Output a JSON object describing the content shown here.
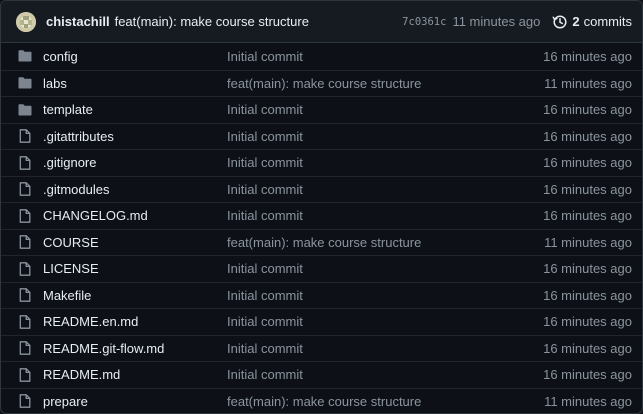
{
  "latest_commit": {
    "author": "chistachill",
    "message": "feat(main): make course structure",
    "sha": "7c0361c",
    "time": "11 minutes ago",
    "commits_count": "2",
    "commits_label": "commits",
    "history_icon": "history-icon"
  },
  "files": [
    {
      "type": "folder",
      "name": "config",
      "message": "Initial commit",
      "age": "16 minutes ago"
    },
    {
      "type": "folder",
      "name": "labs",
      "message": "feat(main): make course structure",
      "age": "11 minutes ago"
    },
    {
      "type": "folder",
      "name": "template",
      "message": "Initial commit",
      "age": "16 minutes ago"
    },
    {
      "type": "file",
      "name": ".gitattributes",
      "message": "Initial commit",
      "age": "16 minutes ago"
    },
    {
      "type": "file",
      "name": ".gitignore",
      "message": "Initial commit",
      "age": "16 minutes ago"
    },
    {
      "type": "file",
      "name": ".gitmodules",
      "message": "Initial commit",
      "age": "16 minutes ago"
    },
    {
      "type": "file",
      "name": "CHANGELOG.md",
      "message": "Initial commit",
      "age": "16 minutes ago"
    },
    {
      "type": "file",
      "name": "COURSE",
      "message": "feat(main): make course structure",
      "age": "11 minutes ago"
    },
    {
      "type": "file",
      "name": "LICENSE",
      "message": "Initial commit",
      "age": "16 minutes ago"
    },
    {
      "type": "file",
      "name": "Makefile",
      "message": "Initial commit",
      "age": "16 minutes ago"
    },
    {
      "type": "file",
      "name": "README.en.md",
      "message": "Initial commit",
      "age": "16 minutes ago"
    },
    {
      "type": "file",
      "name": "README.git-flow.md",
      "message": "Initial commit",
      "age": "16 minutes ago"
    },
    {
      "type": "file",
      "name": "README.md",
      "message": "Initial commit",
      "age": "16 minutes ago"
    },
    {
      "type": "file",
      "name": "prepare",
      "message": "feat(main): make course structure",
      "age": "11 minutes ago"
    }
  ],
  "colors": {
    "background": "#0d1117",
    "header_background": "#161b22",
    "border": "#30363d",
    "text": "#e6edf3",
    "muted": "#8b949e",
    "folder_icon": "#7d8590"
  }
}
